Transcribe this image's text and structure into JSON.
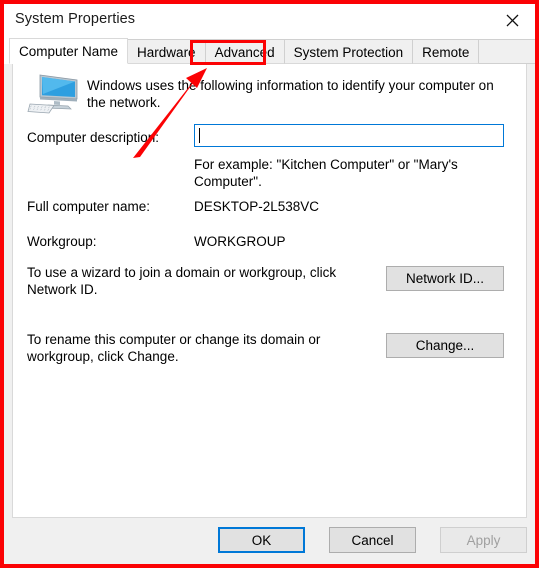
{
  "window": {
    "title": "System Properties",
    "close_icon": "close-icon"
  },
  "tabs": [
    {
      "label": "Computer Name",
      "selected": true
    },
    {
      "label": "Hardware",
      "selected": false
    },
    {
      "label": "Advanced",
      "selected": false
    },
    {
      "label": "System Protection",
      "selected": false
    },
    {
      "label": "Remote",
      "selected": false
    }
  ],
  "content": {
    "icon": "computer-monitor-icon",
    "intro_text": "Windows uses the following information to identify your computer on the network.",
    "description_label": "Computer description:",
    "description_value": "",
    "description_placeholder": "",
    "example_text": "For example: \"Kitchen Computer\" or \"Mary's Computer\".",
    "full_name_label": "Full computer name:",
    "full_name_value": "DESKTOP-2L538VC",
    "workgroup_label": "Workgroup:",
    "workgroup_value": "WORKGROUP",
    "network_id_text": "To use a wizard to join a domain or workgroup, click Network ID.",
    "network_id_button": "Network ID...",
    "change_text": "To rename this computer or change its domain or workgroup, click Change.",
    "change_button": "Change..."
  },
  "footer": {
    "ok_label": "OK",
    "cancel_label": "Cancel",
    "apply_label": "Apply",
    "apply_disabled": true
  },
  "annotations": {
    "highlight_target": "Advanced",
    "arrow_color": "#fb0204",
    "frame_color": "#fb0204"
  }
}
